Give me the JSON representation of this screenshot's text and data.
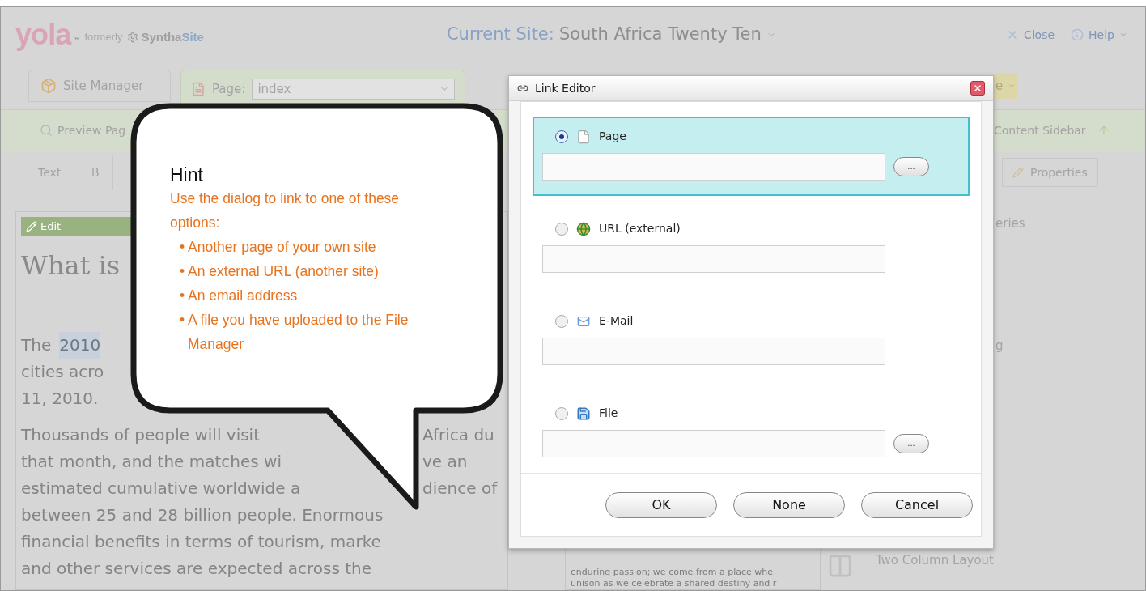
{
  "app": {
    "logo": {
      "brand": "yola",
      "tm": "™",
      "formerly": "formerly",
      "previous_a": "Syntha",
      "previous_b": "Site"
    },
    "current_site": {
      "label": "Current Site:",
      "value": "South Africa Twenty Ten"
    },
    "top_links": [
      {
        "kind": "close",
        "label": "Close"
      },
      {
        "kind": "help",
        "label": "Help"
      }
    ],
    "toolbar": {
      "site_manager": "Site Manager",
      "page_label": "Page:",
      "page_value": "index",
      "partial_button": "e"
    },
    "action_bar": {
      "preview": "Preview Pag",
      "sidebar": "Content Sidebar"
    },
    "format_tabs": [
      {
        "label": "Text"
      },
      {
        "label": "B"
      }
    ],
    "properties_tab": "Properties",
    "edit_bar": "Edit",
    "article": {
      "heading": "What is",
      "lines": [
        {
          "parts": [
            "The"
          ],
          "highlight": "2010"
        },
        {
          "parts": [
            "cities acro"
          ]
        },
        {
          "parts": [
            "11, 2010."
          ]
        },
        {
          "parts": [
            "Thousands of people will visit",
            "Africa du"
          ]
        },
        {
          "parts": [
            "that month, and the matches wi",
            "ve an"
          ]
        },
        {
          "parts": [
            "estimated cumulative worldwide a",
            "dience of"
          ]
        },
        {
          "parts": [
            "between 25 and 28 billion people. Enormous"
          ]
        },
        {
          "parts": [
            "financial benefits in terms of tourism, marke"
          ]
        },
        {
          "parts": [
            "and other services are expected across the"
          ]
        }
      ]
    },
    "right_panel": [
      "eries",
      "g"
    ],
    "snippet_lines": [
      "enduring passion; we come from a place whe",
      "unison as we celebrate a shared destiny and r"
    ],
    "layout_option": "Two Column Layout"
  },
  "callout": {
    "title": "Hint",
    "intro": "Use the dialog to link to one of these options:",
    "bullets": [
      "• Another page of your own site",
      "• An external URL (another site)",
      "• An email address",
      "• A file you have uploaded to the File Manager"
    ]
  },
  "dialog": {
    "title": "Link Editor",
    "options": [
      {
        "kind": "page",
        "label": "Page",
        "selected": true,
        "browse": "..."
      },
      {
        "kind": "url",
        "label": "URL (external)",
        "selected": false
      },
      {
        "kind": "email",
        "label": "E-Mail",
        "selected": false
      },
      {
        "kind": "file",
        "label": "File",
        "selected": false,
        "browse": "..."
      }
    ],
    "buttons": [
      "OK",
      "None",
      "Cancel"
    ]
  }
}
